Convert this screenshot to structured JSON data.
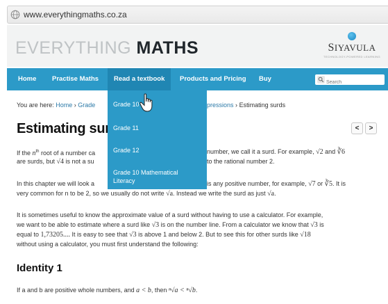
{
  "browser": {
    "url": "www.everythingmaths.co.za"
  },
  "header": {
    "logo_light": "EVERYTHING ",
    "logo_bold": "MATHS",
    "brand": "Siyavula",
    "brand_tagline": "TECHNOLOGY-POWERED LEARNING"
  },
  "nav": {
    "items": [
      "Home",
      "Practise Maths",
      "Read a textbook",
      "Products and Pricing",
      "Buy"
    ],
    "active": "Read a textbook",
    "search_placeholder": "Search"
  },
  "dropdown": {
    "items": [
      "Grade 10",
      "Grade 11",
      "Grade 12",
      "Grade 10 Mathematical",
      "Literacy"
    ]
  },
  "breadcrumb": {
    "prefix": "You are here:",
    "home": "Home",
    "sep": "›",
    "grade": "Grade",
    "tail": "pressions",
    "current": "Estimating surds"
  },
  "content": {
    "title": "Estimating surds",
    "prev_label": "<",
    "next_label": ">",
    "p1_l1a": "If the ",
    "p1_l1_n": "n",
    "p1_l1_th": "th",
    "p1_l1b": " root of a number ca",
    "p1_l1c": "number, we call it a surd. For example, ",
    "p1_l1_ex1": "√2",
    "p1_and": " and ",
    "p1_l1_ex2": "∛6",
    "p1_l2a": "are surds, but ",
    "p1_l2_ex": "√4",
    "p1_l2b": " is not a su",
    "p1_l2c": "to the rational number 2.",
    "p2_l1a": "In this chapter we will look a",
    "p2_l1b": "is any positive number, for example, ",
    "p2_ex1": "√7",
    "p2_or": " or ",
    "p2_ex2": "∛5",
    "p2_end": ". It is",
    "p2_l2a": "very common for n to be 2, so we usually do not write ",
    "p2_l2_ex1": "√a",
    "p2_l2b": ". Instead we write the surd as just ",
    "p2_l2_ex2": "√a",
    "p2_l2_end": ".",
    "p3_l1": "It is sometimes useful to know the approximate value of a surd without having to use a calculator. For example,",
    "p3_l2a": "we want to be able to estimate where a surd like ",
    "p3_l2_ex": "√3",
    "p3_l2b": " is on the number line. From a calculator we know that ",
    "p3_l2_ex2": "√3",
    "p3_l2_end": " is",
    "p3_l3a": "equal to ",
    "p3_l3_num": "1,73205....",
    "p3_l3b": " It is easy to see that ",
    "p3_l3_ex": "√3",
    "p3_l3c": " is above 1 and below 2. But to see this for other surds like ",
    "p3_l3_ex2": "√18",
    "p3_l4": "without using a calculator, you must first understand the following:",
    "identity_heading": "Identity 1",
    "id_line_a": "If a and b are positive whole numbers, and ",
    "id_line_ineq": "a < b",
    "id_line_b": ", then ",
    "id_line_res": "ⁿ√a < ⁿ√b",
    "id_line_end": "."
  },
  "colors": {
    "nav_bg": "#2c9ac8",
    "nav_active": "#2086b3",
    "link": "#2c7aa8"
  }
}
